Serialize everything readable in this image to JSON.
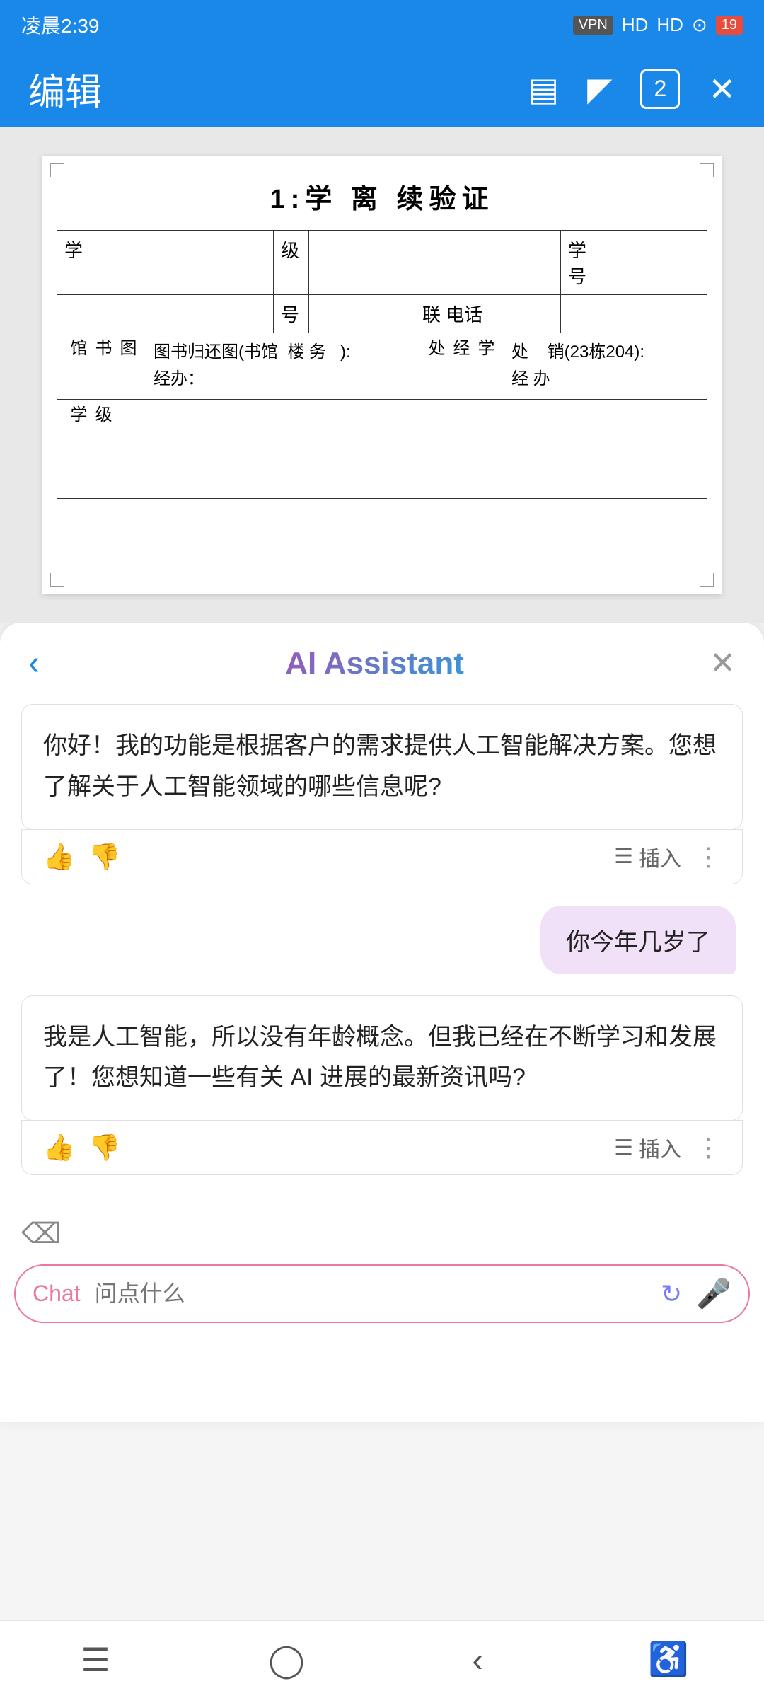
{
  "statusBar": {
    "time": "凌晨2:39",
    "vpn": "VPN",
    "battery": "19",
    "signalHD1": "HD",
    "signalHD2": "HD"
  },
  "toolbar": {
    "title": "编辑",
    "tabCount": "2"
  },
  "document": {
    "title": "1:学   离      续验证",
    "cornerMarks": true
  },
  "aiPanel": {
    "title": "AI Assistant",
    "backLabel": "‹",
    "closeLabel": "×"
  },
  "chat": {
    "botMsg1": "你好！我的功能是根据客户的需求提供人工智能解决方案。您想了解关于人工智能领域的哪些信息呢?",
    "userMsg1": "你今年几岁了",
    "botMsg2": "我是人工智能，所以没有年龄概念。但我已经在不断学习和发展了！您想知道一些有关 AI 进展的最新资讯吗?",
    "insertLabel": "插入",
    "moreLabel": "⋮"
  },
  "inputArea": {
    "chatLabel": "Chat",
    "placeholder": "问点什么",
    "historyIcon": "↺",
    "micIcon": "🎤"
  },
  "bottomNav": {
    "menuIcon": "☰",
    "homeIcon": "○",
    "backIcon": "‹",
    "accessibilityIcon": "♿"
  },
  "tableData": {
    "row1": [
      "学",
      "",
      "级",
      "",
      "",
      "",
      "学",
      ""
    ],
    "row2": [
      "",
      "",
      "号",
      "",
      "联  电话",
      "",
      "",
      ""
    ],
    "row3left": "图书馆",
    "row3leftContent": "图书归还图(书馆  楼 务   ):\n经办：",
    "row3rightLabel": "学\n经\n处",
    "row3rightContent": "处    销(23栋204):\n经 办",
    "row4label": "级\n学",
    "row4content": ""
  }
}
